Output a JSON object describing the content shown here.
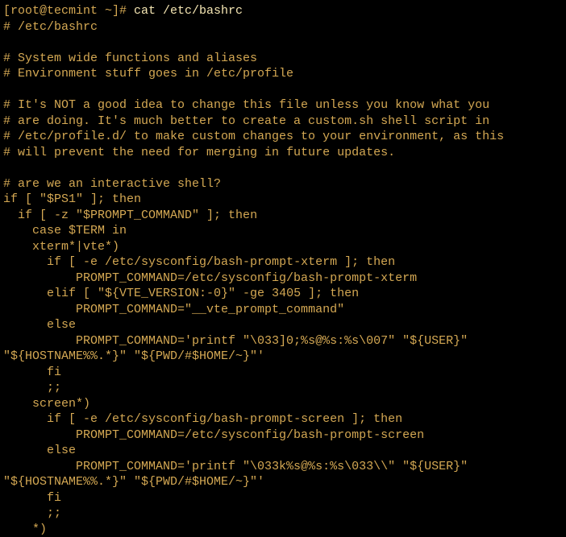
{
  "prompt": "[root@tecmint ~]# ",
  "command": "cat /etc/bashrc",
  "lines": {
    "l1": "# /etc/bashrc",
    "l2": "",
    "l3": "# System wide functions and aliases",
    "l4": "# Environment stuff goes in /etc/profile",
    "l5": "",
    "l6": "# It's NOT a good idea to change this file unless you know what you",
    "l7": "# are doing. It's much better to create a custom.sh shell script in",
    "l8": "# /etc/profile.d/ to make custom changes to your environment, as this",
    "l9": "# will prevent the need for merging in future updates.",
    "l10": "",
    "l11": "# are we an interactive shell?",
    "l12": "if [ \"$PS1\" ]; then",
    "l13": "  if [ -z \"$PROMPT_COMMAND\" ]; then",
    "l14": "    case $TERM in",
    "l15": "    xterm*|vte*)",
    "l16": "      if [ -e /etc/sysconfig/bash-prompt-xterm ]; then",
    "l17": "          PROMPT_COMMAND=/etc/sysconfig/bash-prompt-xterm",
    "l18": "      elif [ \"${VTE_VERSION:-0}\" -ge 3405 ]; then",
    "l19": "          PROMPT_COMMAND=\"__vte_prompt_command\"",
    "l20": "      else",
    "l21": "          PROMPT_COMMAND='printf \"\\033]0;%s@%s:%s\\007\" \"${USER}\" \"${HOSTNAME%%.*}\" \"${PWD/#$HOME/~}\"'",
    "l22": "      fi",
    "l23": "      ;;",
    "l24": "    screen*)",
    "l25": "      if [ -e /etc/sysconfig/bash-prompt-screen ]; then",
    "l26": "          PROMPT_COMMAND=/etc/sysconfig/bash-prompt-screen",
    "l27": "      else",
    "l28": "          PROMPT_COMMAND='printf \"\\033k%s@%s:%s\\033\\\\\" \"${USER}\" \"${HOSTNAME%%.*}\" \"${PWD/#$HOME/~}\"'",
    "l29": "      fi",
    "l30": "      ;;",
    "l31": "    *)"
  }
}
